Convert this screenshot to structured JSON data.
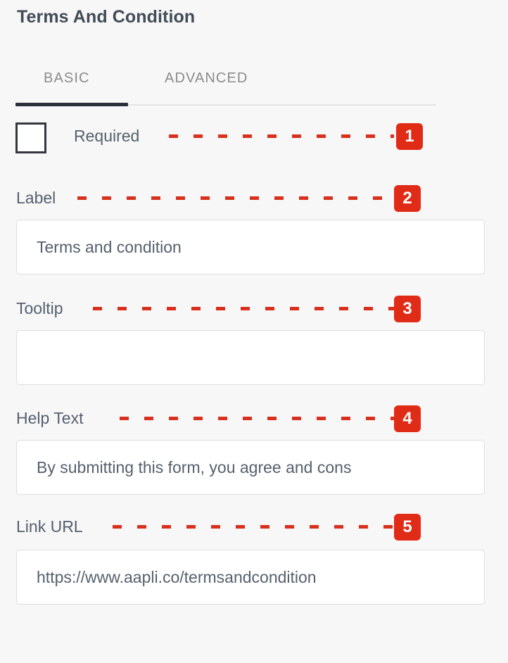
{
  "panel": {
    "title": "Terms And Condition"
  },
  "tabs": [
    {
      "label": "BASIC",
      "active": true
    },
    {
      "label": "ADVANCED",
      "active": false
    }
  ],
  "required_row": {
    "label": "Required",
    "checked": false,
    "badge": "1"
  },
  "fields": [
    {
      "label": "Label",
      "value": "Terms and condition",
      "placeholder": "",
      "badge": "2"
    },
    {
      "label": "Tooltip",
      "value": "",
      "placeholder": "",
      "badge": "3"
    },
    {
      "label": "Help Text",
      "value": "By submitting this form, you agree and cons",
      "placeholder": "",
      "badge": "4"
    },
    {
      "label": "Link URL",
      "value": "https://www.aapli.co/termsandcondition",
      "placeholder": "",
      "badge": "5"
    }
  ],
  "colors": {
    "background": "#f7f7f7",
    "accent_red": "#e02b17",
    "dash_red": "#d8301c",
    "title_text": "#424b57",
    "label_text": "#55606e",
    "tab_inactive": "#8b8b8b",
    "tab_active_underline": "#2b2f38",
    "input_border": "#dedede",
    "input_background": "#ffffff",
    "checkbox_border": "#33373f"
  }
}
